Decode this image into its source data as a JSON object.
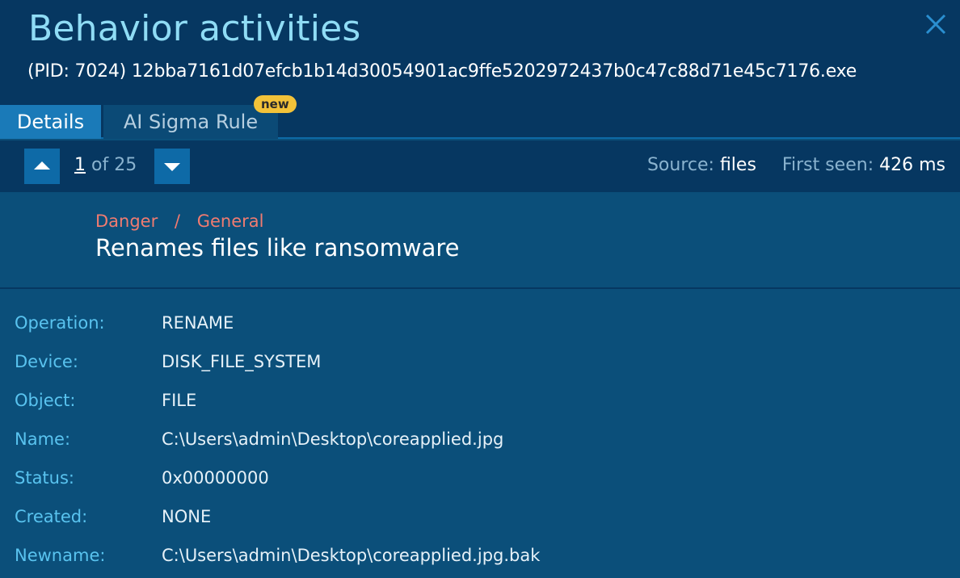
{
  "dialog": {
    "title": "Behavior activities",
    "pid_line": "(PID: 7024) 12bba7161d07efcb1b14d30054901ac9ffe5202972437b0c47c88d71e45c7176.exe",
    "close_icon": "close-icon"
  },
  "tabs": [
    {
      "label": "Details",
      "active": true
    },
    {
      "label": "AI Sigma Rule",
      "active": false,
      "badge": "new"
    }
  ],
  "navigation": {
    "current": "1",
    "of_total": "of 25",
    "up_icon": "chevron-up-icon",
    "down_icon": "chevron-down-icon"
  },
  "meta": {
    "source_label": "Source:",
    "source_value": "files",
    "first_seen_label": "First seen:",
    "first_seen_value": "426 ms"
  },
  "summary": {
    "severity": "Danger",
    "separator": "/",
    "category": "General",
    "title": "Renames files like ransomware"
  },
  "details": [
    {
      "label": "Operation:",
      "value": "RENAME"
    },
    {
      "label": "Device:",
      "value": "DISK_FILE_SYSTEM"
    },
    {
      "label": "Object:",
      "value": "FILE"
    },
    {
      "label": "Name:",
      "value": "C:\\Users\\admin\\Desktop\\coreapplied.jpg"
    },
    {
      "label": "Status:",
      "value": "0x00000000"
    },
    {
      "label": "Created:",
      "value": "NONE"
    },
    {
      "label": "Newname:",
      "value": "C:\\Users\\admin\\Desktop\\coreapplied.jpg.bak"
    }
  ],
  "colors": {
    "header_bg": "#063761",
    "panel_bg": "#0b4f7a",
    "title": "#8fdcf5",
    "danger": "#f07b70",
    "label": "#59c3ef",
    "badge": "#f2c239"
  }
}
